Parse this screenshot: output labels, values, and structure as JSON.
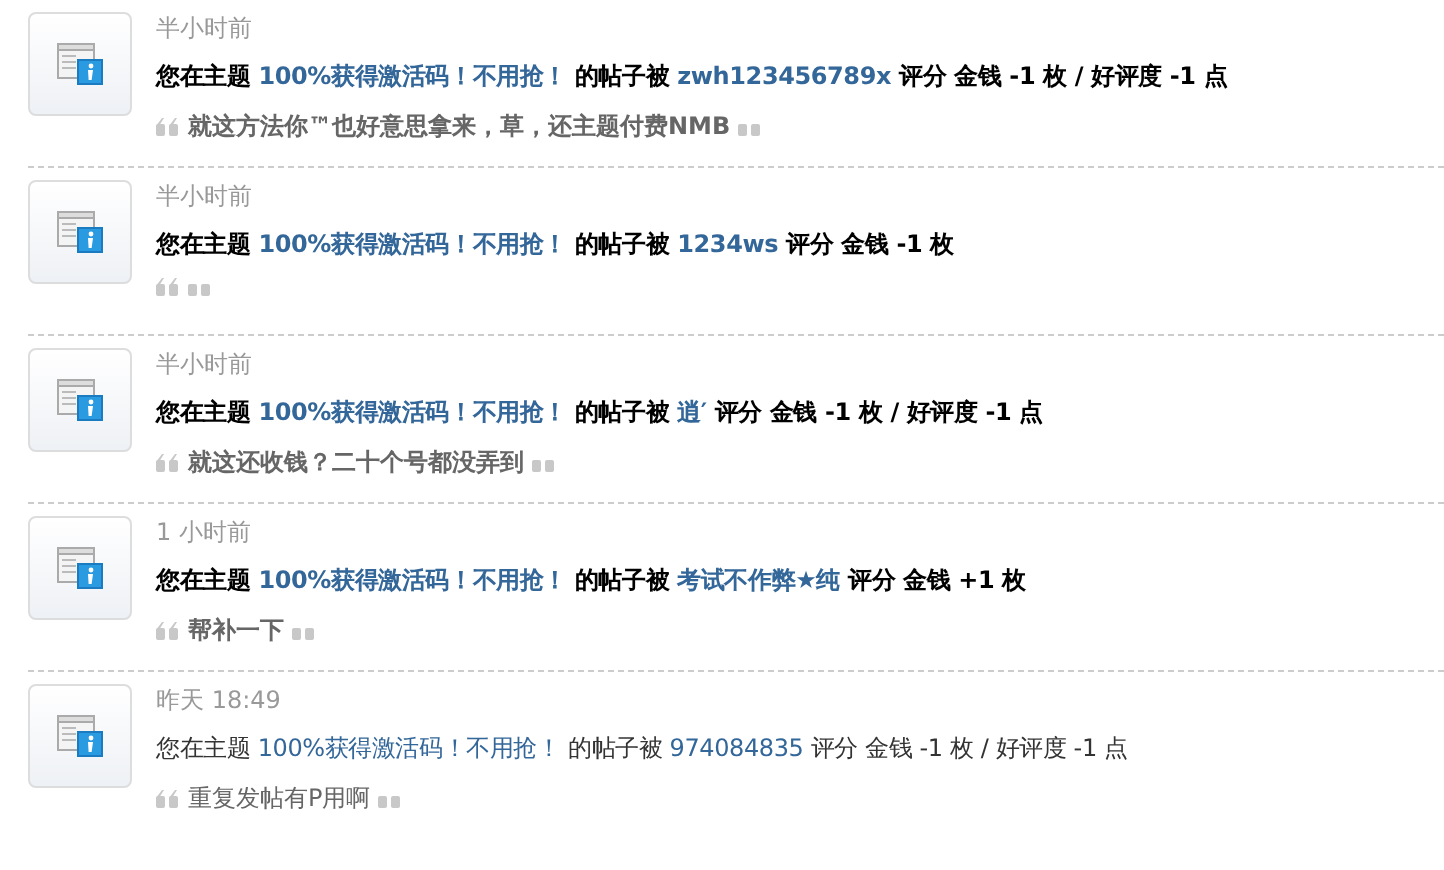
{
  "notifications": [
    {
      "time": "半小时前",
      "new": true,
      "prefix": "您在主题",
      "thread": "100%获得激活码！不用抢！",
      "middle": "的帖子被",
      "user": "zwh123456789x",
      "suffix": "评分 金钱 -1 枚 / 好评度 -1 点",
      "comment": "就这方法你™也好意思拿来，草，还主题付费NMB"
    },
    {
      "time": "半小时前",
      "new": true,
      "prefix": "您在主题",
      "thread": "100%获得激活码！不用抢！",
      "middle": "的帖子被",
      "user": "1234ws",
      "suffix": "评分 金钱 -1 枚"
    },
    {
      "time": "半小时前",
      "new": true,
      "prefix": "您在主题",
      "thread": "100%获得激活码！不用抢！",
      "middle": "的帖子被",
      "user": "逍′",
      "suffix": "评分 金钱 -1 枚 / 好评度 -1 点",
      "comment": "就这还收钱？二十个号都没弄到"
    },
    {
      "time": "1 小时前",
      "new": true,
      "prefix": "您在主题",
      "thread": "100%获得激活码！不用抢！",
      "middle": "的帖子被",
      "user": "考试不作弊★纯",
      "suffix": "评分 金钱 +1 枚",
      "comment": "帮补一下"
    },
    {
      "time": "昨天 18:49",
      "new": false,
      "prefix": "您在主题",
      "thread": "100%获得激活码！不用抢！",
      "middle": "的帖子被",
      "user": "974084835",
      "suffix": "评分 金钱 -1 枚 / 好评度 -1 点",
      "comment": "重复发帖有P用啊"
    }
  ]
}
